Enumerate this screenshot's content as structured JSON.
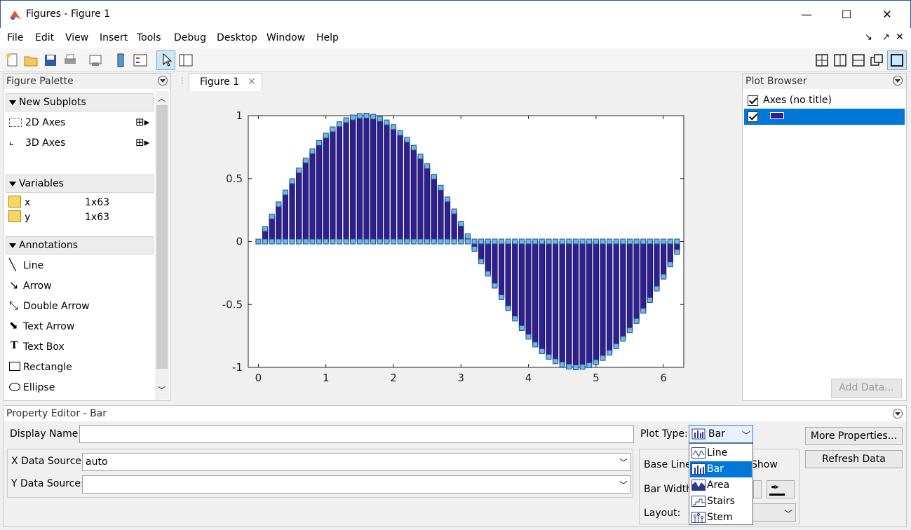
{
  "window": {
    "title": "Figures - Figure 1",
    "min": "—",
    "max": "☐",
    "close": "✕"
  },
  "menu": [
    "File",
    "Edit",
    "View",
    "Insert",
    "Tools",
    "Debug",
    "Desktop",
    "Window",
    "Help"
  ],
  "palette": {
    "title": "Figure Palette",
    "sections": {
      "subplots": "New Subplots",
      "variables": "Variables",
      "annotations": "Annotations"
    },
    "subplots": [
      "2D Axes",
      "3D Axes"
    ],
    "variables": [
      {
        "name": "x",
        "size": "1x63"
      },
      {
        "name": "y",
        "size": "1x63"
      }
    ],
    "annotations": [
      "Line",
      "Arrow",
      "Double Arrow",
      "Text Arrow",
      "Text Box",
      "Rectangle",
      "Ellipse"
    ]
  },
  "figure_tab": "Figure 1",
  "plot_browser": {
    "title": "Plot Browser",
    "axes_label": "Axes (no title)",
    "add_data": "Add Data..."
  },
  "property_editor": {
    "title": "Property Editor - Bar",
    "display_name_label": "Display Name:",
    "display_name_value": "",
    "x_source_label": "X Data Source:",
    "x_source_value": "auto",
    "y_source_label": "Y Data Source:",
    "y_source_value": "",
    "plot_type_label": "Plot Type:",
    "plot_type_value": "Bar",
    "base_line_label": "Base Line:",
    "show_label": "Show",
    "bar_width_label": "Bar Width:",
    "layout_label": "Layout:",
    "more_props": "More Properties...",
    "refresh": "Refresh Data",
    "plot_types": [
      "Line",
      "Bar",
      "Area",
      "Stairs",
      "Stem"
    ],
    "selected_type": "Bar"
  },
  "colors": {
    "bar_fill": "#2e1f94",
    "marker": "#6fb7e6",
    "selection": "#0078d7"
  },
  "chart_data": {
    "type": "bar",
    "function": "sin",
    "x_start": 0,
    "x_step": 0.1,
    "n": 63,
    "xlim": [
      -0.15,
      6.3
    ],
    "ylim": [
      -1,
      1
    ],
    "xticks": [
      "0",
      "1",
      "2",
      "3",
      "4",
      "5",
      "6"
    ],
    "yticks": [
      "1",
      "0.5",
      "0",
      "-0.5",
      "-1"
    ],
    "title": "",
    "xlabel": "",
    "ylabel": ""
  }
}
